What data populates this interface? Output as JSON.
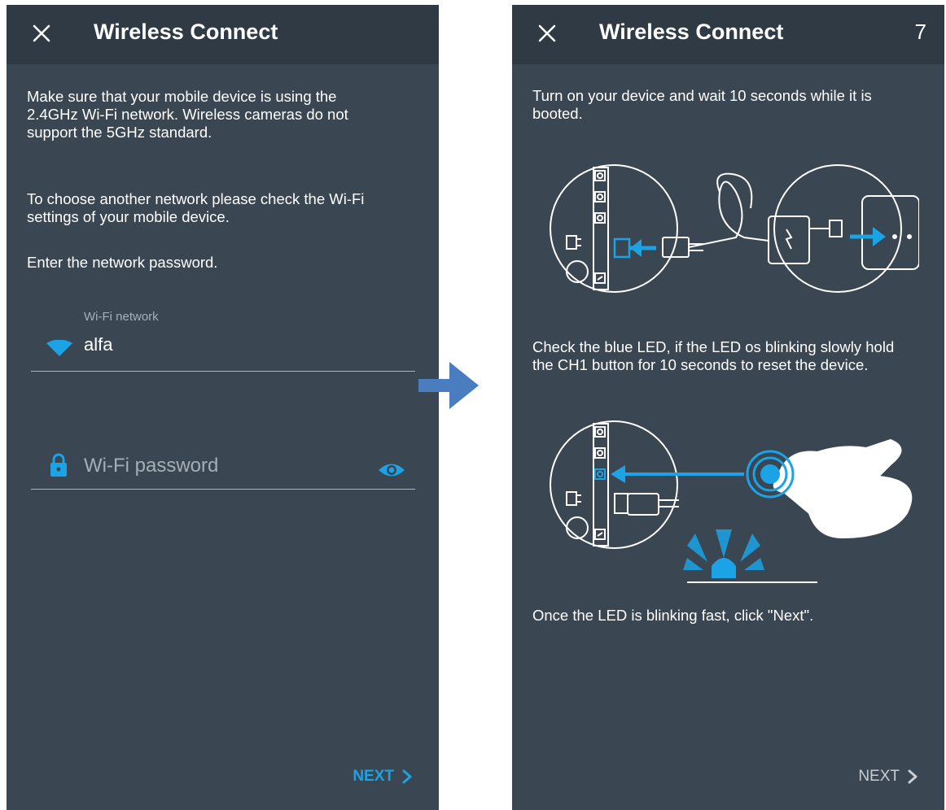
{
  "left": {
    "title": "Wireless Connect",
    "paragraphs": [
      "Make sure that your mobile device is using the\n2.4GHz Wi-Fi network. Wireless cameras do not\nsupport the 5GHz standard.",
      "To choose another network please check the Wi-Fi\nsettings of your mobile device.",
      "Enter the network password."
    ],
    "wifi_label": "Wi-Fi network",
    "wifi_value": "alfa",
    "password_placeholder": "Wi-Fi password",
    "next_label": "NEXT",
    "icons": {
      "close": "close-icon",
      "wifi": "wifi-icon",
      "lock": "lock-icon",
      "eye": "eye-icon",
      "chevron": "chevron-right-icon"
    }
  },
  "right": {
    "title": "Wireless Connect",
    "step_number": "7",
    "instructions": [
      "Turn on your device and wait 10 seconds while it is\nbooted.",
      "Check the blue LED, if the LED os blinking slowly hold\nthe CH1 button for 10 seconds to reset the device.",
      "Once the LED is blinking fast, click \"Next\"."
    ],
    "next_label": "NEXT"
  },
  "colors": {
    "background": "#3a4651",
    "topbar": "#2f3a44",
    "accent": "#1ba3e6",
    "arrow": "#4a7cc0"
  }
}
